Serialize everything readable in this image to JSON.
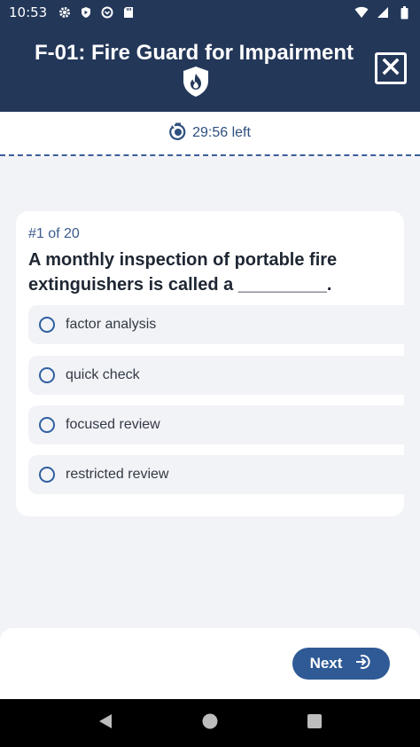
{
  "status_bar": {
    "time": "10:53"
  },
  "header": {
    "title": "F-01: Fire Guard for Impairment"
  },
  "timer": {
    "text": "29:56 left"
  },
  "question": {
    "counter": "#1 of 20",
    "text": "A monthly inspection of portable fire extinguishers is called a _________.",
    "options": [
      {
        "label": "factor analysis"
      },
      {
        "label": "quick check"
      },
      {
        "label": "focused review"
      },
      {
        "label": "restricted review"
      }
    ]
  },
  "footer": {
    "next_label": "Next"
  },
  "colors": {
    "header_bg": "#233759",
    "accent": "#2f5a96",
    "page_bg": "#f2f3f7"
  }
}
